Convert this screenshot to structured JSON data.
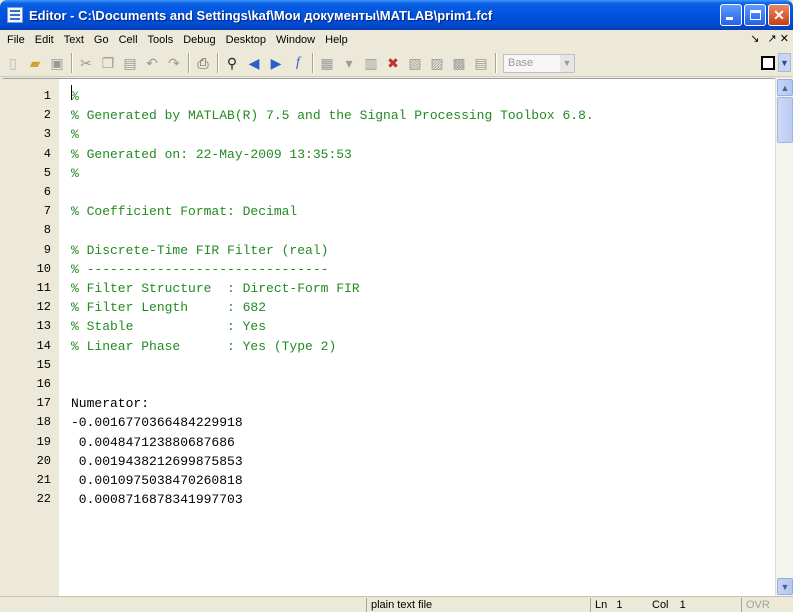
{
  "window": {
    "title": "Editor - C:\\Documents and Settings\\kaf\\Мои документы\\MATLAB\\prim1.fcf",
    "buttons": {
      "minimize": "minimize",
      "maximize": "maximize",
      "close": "close"
    }
  },
  "menu": {
    "items": [
      "File",
      "Edit",
      "Text",
      "Go",
      "Cell",
      "Tools",
      "Debug",
      "Desktop",
      "Window",
      "Help"
    ],
    "right_icons": [
      "dock-arrow-icon",
      "undock-close-icon"
    ]
  },
  "toolbar": {
    "icons": [
      "new-file-icon",
      "open-folder-icon",
      "save-icon",
      "cut-icon",
      "copy-icon",
      "paste-icon",
      "undo-icon",
      "redo-icon",
      "print-icon",
      "find-icon",
      "back-icon",
      "forward-icon",
      "function-icon",
      "breakpoint-icon",
      "stack-icon",
      "step-icon",
      "step-in-icon",
      "step-out-icon",
      "continue-icon",
      "exit-debug-icon"
    ],
    "base_label": "Base",
    "colors": {
      "comment": "#228b22",
      "code": "#000000"
    }
  },
  "editor": {
    "lines": [
      {
        "n": "1",
        "text": "%",
        "type": "comment"
      },
      {
        "n": "2",
        "text": "% Generated by MATLAB(R) 7.5 and the Signal Processing Toolbox 6.8.",
        "type": "comment"
      },
      {
        "n": "3",
        "text": "%",
        "type": "comment"
      },
      {
        "n": "4",
        "text": "% Generated on: 22-May-2009 13:35:53",
        "type": "comment"
      },
      {
        "n": "5",
        "text": "%",
        "type": "comment"
      },
      {
        "n": "6",
        "text": "",
        "type": "code"
      },
      {
        "n": "7",
        "text": "% Coefficient Format: Decimal",
        "type": "comment"
      },
      {
        "n": "8",
        "text": "",
        "type": "code"
      },
      {
        "n": "9",
        "text": "% Discrete-Time FIR Filter (real)",
        "type": "comment"
      },
      {
        "n": "10",
        "text": "% -------------------------------",
        "type": "comment"
      },
      {
        "n": "11",
        "text": "% Filter Structure  : Direct-Form FIR",
        "type": "comment"
      },
      {
        "n": "12",
        "text": "% Filter Length     : 682",
        "type": "comment"
      },
      {
        "n": "13",
        "text": "% Stable            : Yes",
        "type": "comment"
      },
      {
        "n": "14",
        "text": "% Linear Phase      : Yes (Type 2)",
        "type": "comment"
      },
      {
        "n": "15",
        "text": "",
        "type": "code"
      },
      {
        "n": "16",
        "text": "",
        "type": "code"
      },
      {
        "n": "17",
        "text": "Numerator:",
        "type": "code"
      },
      {
        "n": "18",
        "text": "-0.0016770366484229918",
        "type": "code"
      },
      {
        "n": "19",
        "text": " 0.004847123880687686",
        "type": "code"
      },
      {
        "n": "20",
        "text": " 0.0019438212699875853",
        "type": "code"
      },
      {
        "n": "21",
        "text": " 0.0010975038470260818",
        "type": "code"
      },
      {
        "n": "22",
        "text": " 0.0008716878341997703",
        "type": "code"
      }
    ]
  },
  "status": {
    "file_type": "plain text file",
    "ln_label": "Ln",
    "ln_value": "1",
    "col_label": "Col",
    "col_value": "1",
    "ovr": "OVR"
  }
}
